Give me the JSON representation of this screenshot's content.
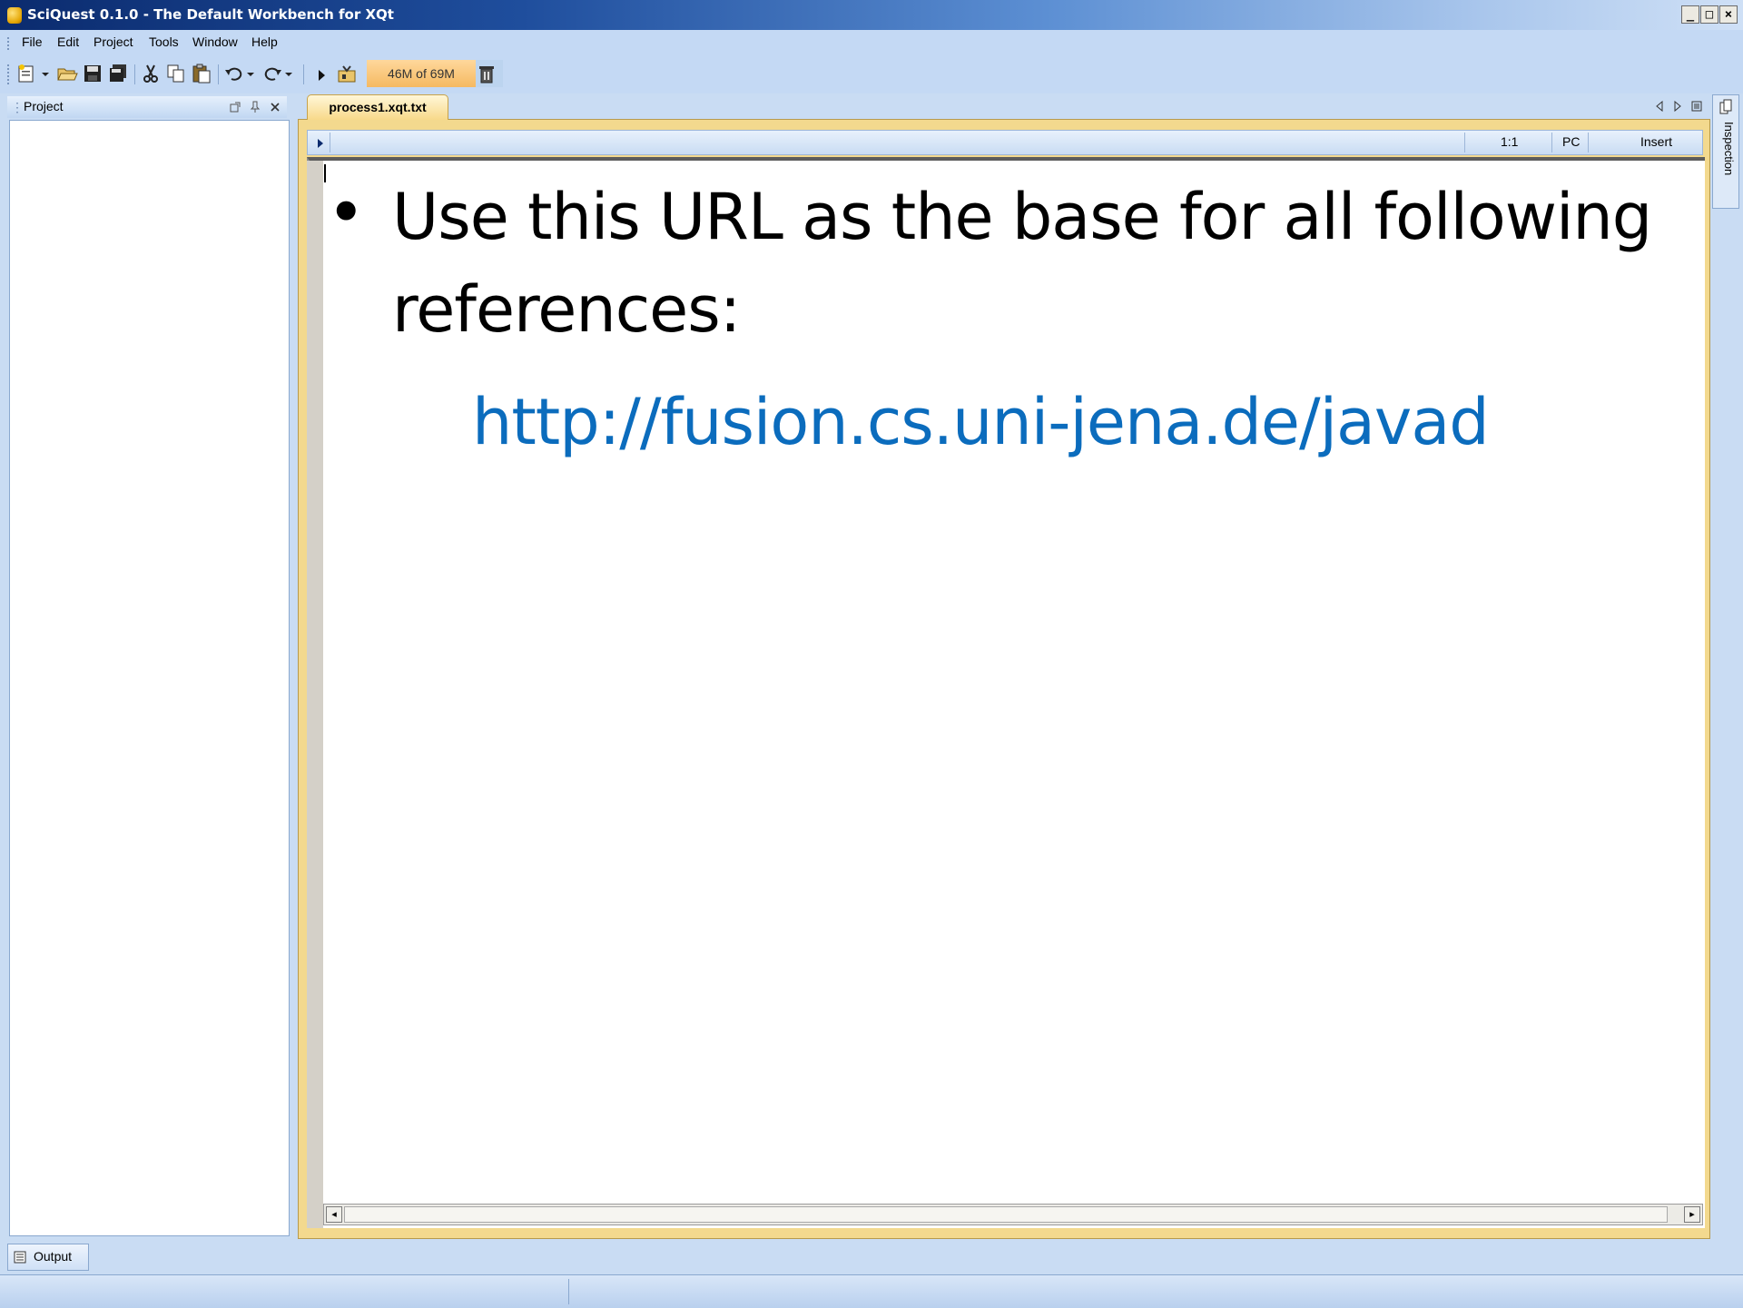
{
  "window": {
    "title": "SciQuest 0.1.0 - The Default Workbench for XQt"
  },
  "menu": [
    "File",
    "Edit",
    "Project",
    "Tools",
    "Window",
    "Help"
  ],
  "toolbar": {
    "memory_label": "46M of 69M"
  },
  "project_panel": {
    "title": "Project"
  },
  "editor": {
    "tab_label": "process1.xqt.txt",
    "status": {
      "position": "1:1",
      "line_ending": "PC",
      "mode": "Insert"
    }
  },
  "slide": {
    "bullet": "•",
    "line1": "Use this URL as the base for all following",
    "line2": "references:",
    "url": "http://fusion.cs.uni-jena.de/javad"
  },
  "side_panel": {
    "label": "Inspection"
  },
  "bottom": {
    "output_tab": "Output"
  },
  "colors": {
    "url": "#0b6cbd",
    "active_tab": "#f8d98a",
    "memory_bar": "#f5b961",
    "chrome": "#c4d9f4"
  }
}
